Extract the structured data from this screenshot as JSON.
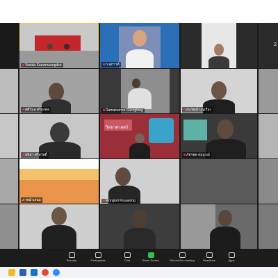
{
  "grid": {
    "tiles": [
      {
        "name": "Vanida Kaewmuangdee",
        "mic_off": true,
        "active": true
      },
      {
        "name": "ก.สุภาวดี",
        "mic_off": true
      },
      {
        "name": "",
        "mic_off": false
      },
      {
        "name": "2",
        "mic_off": false
      },
      {
        "name": "",
        "mic_off": false
      },
      {
        "name": "ศศิวิมล ศรีมงคล",
        "mic_off": true
      },
      {
        "name": "Ratnakamon Saengtong",
        "mic_off": true
      },
      {
        "name": "ธนวัฒน์ บุญเรือง",
        "mic_off": true
      },
      {
        "name": "",
        "mic_off": false
      },
      {
        "name": "สุนิสา ศรีสวัสดิ์",
        "mic_off": true
      },
      {
        "name": "วิทยาศาสตร์",
        "mic_off": false
      },
      {
        "name": "ภัทรพล สมบูรณ์",
        "mic_off": true
      },
      {
        "name": "",
        "mic_off": false
      },
      {
        "name": "ภาพนำเสนอ",
        "mic_off": false
      },
      {
        "name": "Mongkol Kruawong",
        "mic_off": true
      },
      {
        "name": "",
        "mic_off": false
      },
      {
        "name": "",
        "mic_off": false
      },
      {
        "name": "",
        "mic_off": false
      },
      {
        "name": "",
        "mic_off": false
      },
      {
        "name": "",
        "mic_off": false
      }
    ]
  },
  "toolbar": {
    "items": [
      {
        "label": "Security",
        "icon": "shield-icon"
      },
      {
        "label": "Participants",
        "icon": "participants-icon"
      },
      {
        "label": "Chat",
        "icon": "chat-icon"
      },
      {
        "label": "Share Screen",
        "icon": "share-screen-icon"
      },
      {
        "label": "Record this meeting",
        "icon": "record-icon"
      },
      {
        "label": "Reactions",
        "icon": "smile-icon"
      },
      {
        "label": "Apps",
        "icon": "apps-icon"
      }
    ]
  },
  "taskbar": {
    "icons": [
      {
        "name": "file-explorer-icon",
        "color": "#f3b92c"
      },
      {
        "name": "word-icon",
        "color": "#2b5fb8"
      },
      {
        "name": "outlook-icon",
        "color": "#1673d1"
      },
      {
        "name": "chrome-icon",
        "color": "#e9453b"
      },
      {
        "name": "zoom-icon",
        "color": "#2d8cff"
      }
    ]
  }
}
